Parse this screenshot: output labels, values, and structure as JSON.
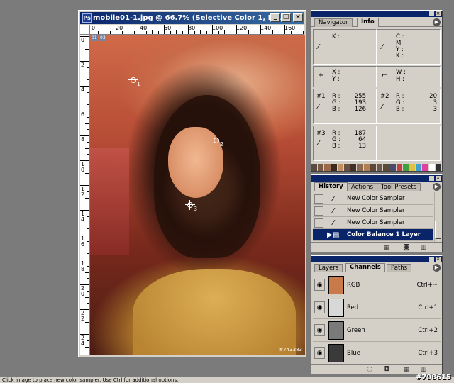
{
  "document": {
    "title": "mobile01-1.jpg @ 66.7% (Selective Color 1, La...",
    "icon": "photoshop-icon",
    "ruler_h_labels": [
      "0",
      "20",
      "40",
      "60",
      "80",
      "100",
      "120",
      "140",
      "160"
    ],
    "ruler_v_labels": [
      "0",
      "2",
      "4",
      "6",
      "8",
      "1 0",
      "1 2",
      "1 4",
      "1 6",
      "1 8",
      "2 0",
      "2 2",
      "2 4"
    ],
    "ruler_tags": [
      "01",
      "03"
    ],
    "image_watermark": "#743383",
    "samplers": [
      "1",
      "2",
      "3"
    ]
  },
  "info_panel": {
    "tabs": [
      "Navigator",
      "Info"
    ],
    "active_tab": "Info",
    "k_label": "K :",
    "cmyk": [
      "C :",
      "M :",
      "Y :",
      "K :"
    ],
    "xy": [
      "X :",
      "Y :"
    ],
    "wh": [
      "W :",
      "H :"
    ],
    "samplers": [
      {
        "id": "#1",
        "R": "255",
        "G": "193",
        "B": "126"
      },
      {
        "id": "#2",
        "R": "20",
        "G": "3",
        "B": "3"
      },
      {
        "id": "#3",
        "R": "187",
        "G": "64",
        "B": "13"
      }
    ],
    "rgb_labels": [
      "R :",
      "G :",
      "B :"
    ],
    "swatches": [
      "#5a4a40",
      "#7a5a44",
      "#9a6a4a",
      "#3a2a22",
      "#c09060",
      "#6a5040",
      "#403028",
      "#8a6a50",
      "#b08050",
      "#604838",
      "#705848",
      "#5a4a38",
      "#4a4a6a",
      "#c04040",
      "#40a040",
      "#e0c040",
      "#40a0d0",
      "#e040a0",
      "#ffffff",
      "#303030"
    ]
  },
  "history_panel": {
    "tabs": [
      "History",
      "Actions",
      "Tool Presets"
    ],
    "active_tab": "History",
    "items": [
      {
        "label": "New Color Sampler"
      },
      {
        "label": "New Color Sampler"
      },
      {
        "label": "New Color Sampler"
      },
      {
        "label": "Color Balance 1 Layer"
      }
    ]
  },
  "layers_panel": {
    "tabs": [
      "Layers",
      "Channels",
      "Paths"
    ],
    "active_tab": "Channels",
    "channels": [
      {
        "name": "RGB",
        "shortcut": "Ctrl+~",
        "thumb": "#c87a4a"
      },
      {
        "name": "Red",
        "shortcut": "Ctrl+1",
        "thumb": "#d8d8d8"
      },
      {
        "name": "Green",
        "shortcut": "Ctrl+2",
        "thumb": "#7a7a7a"
      },
      {
        "name": "Blue",
        "shortcut": "Ctrl+3",
        "thumb": "#3a3a3a"
      }
    ]
  },
  "status_bar": {
    "text": "Click image to place new color sampler. Use Ctrl for additional options."
  },
  "corner_watermark": "#798615"
}
